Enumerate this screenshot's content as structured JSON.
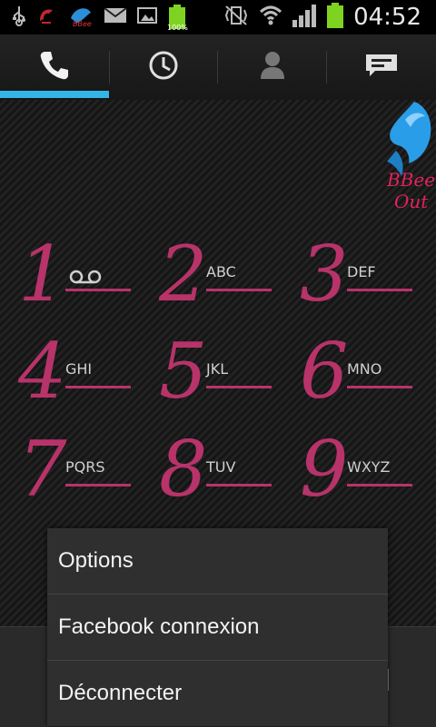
{
  "status_bar": {
    "time": "04:52",
    "battery_percent": "100%",
    "notification_logo_text": "BBee",
    "icons": [
      "usb-icon",
      "app-notification-icon",
      "bbee-notification-icon",
      "mail-icon",
      "gallery-icon",
      "battery-full-icon",
      "vibrate-mute-icon",
      "wifi-icon",
      "signal-icon",
      "battery-icon"
    ]
  },
  "tabs": [
    {
      "name": "phone",
      "icon": "phone-icon",
      "selected": true
    },
    {
      "name": "recent",
      "icon": "clock-icon",
      "selected": false
    },
    {
      "name": "contacts",
      "icon": "person-icon",
      "selected": false
    },
    {
      "name": "messages",
      "icon": "message-icon",
      "selected": false
    }
  ],
  "logo": {
    "line1": "BBee",
    "line2": "Out"
  },
  "keys": [
    {
      "digit": "1",
      "letters": ""
    },
    {
      "digit": "2",
      "letters": "ABC"
    },
    {
      "digit": "3",
      "letters": "DEF"
    },
    {
      "digit": "4",
      "letters": "GHI"
    },
    {
      "digit": "5",
      "letters": "JKL"
    },
    {
      "digit": "6",
      "letters": "MNO"
    },
    {
      "digit": "7",
      "letters": "PQRS"
    },
    {
      "digit": "8",
      "letters": "TUV"
    },
    {
      "digit": "9",
      "letters": "WXYZ"
    }
  ],
  "menu": {
    "items": [
      "Options",
      "Facebook connexion",
      "Déconnecter"
    ]
  },
  "colors": {
    "accent": "#33b5e5",
    "digit": "#b8336a",
    "battery_green": "#7ed321"
  }
}
